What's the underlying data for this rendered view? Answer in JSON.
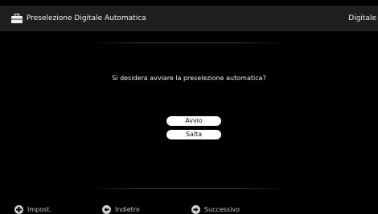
{
  "header": {
    "title": "Preselezione Digitale Automatica",
    "mode": "Digitale",
    "icon": "toolbox-icon"
  },
  "dialog": {
    "question": "Si desidera avviare la preselezione automatica?",
    "start_label": "Avvio",
    "skip_label": "Salta"
  },
  "footer": {
    "setup": {
      "icon": "plus-circle-icon",
      "label": "Impost."
    },
    "back": {
      "icon": "arrow-left-circle-icon",
      "label": "Indietro"
    },
    "next": {
      "icon": "arrow-right-circle-icon",
      "label": "Successivo"
    }
  }
}
